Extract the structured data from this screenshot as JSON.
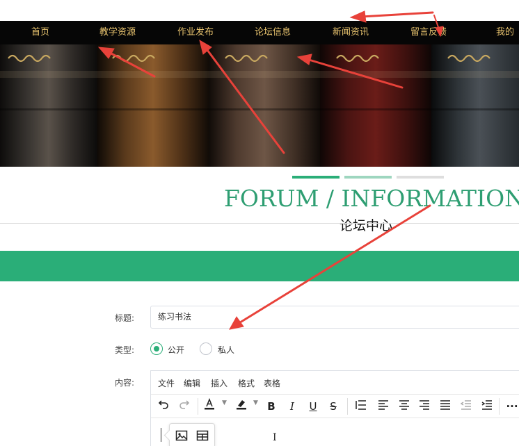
{
  "nav": {
    "items": [
      {
        "label": "首页"
      },
      {
        "label": "教学资源"
      },
      {
        "label": "作业发布"
      },
      {
        "label": "论坛信息"
      },
      {
        "label": "新闻资讯"
      },
      {
        "label": "留言反馈"
      },
      {
        "label": "我的"
      }
    ],
    "text_color": "#e9c46f",
    "background": "#060606"
  },
  "section": {
    "title_en": "FORUM / INFORMATION",
    "title_zh": "论坛中心",
    "accent_color": "#2aae78"
  },
  "form": {
    "title_label": "标题:",
    "title_value": "练习书法",
    "type_label": "类型:",
    "type_options": [
      {
        "label": "公开",
        "checked": true
      },
      {
        "label": "私人",
        "checked": false
      }
    ],
    "content_label": "内容:"
  },
  "editor": {
    "menu": [
      {
        "label": "文件"
      },
      {
        "label": "编辑"
      },
      {
        "label": "插入"
      },
      {
        "label": "格式"
      },
      {
        "label": "表格"
      }
    ],
    "toolbar_icons": [
      "undo-icon",
      "redo-icon",
      "text-color-icon",
      "highlight-icon",
      "bold-icon",
      "italic-icon",
      "underline-icon",
      "strikethrough-icon",
      "line-height-icon",
      "align-left-icon",
      "align-center-icon",
      "align-right-icon",
      "align-justify-icon",
      "outdent-icon",
      "indent-icon",
      "more-icon"
    ],
    "toolbar_glyphs": {
      "bold": "B",
      "italic": "I",
      "underline": "U",
      "strike": "S",
      "more": "···"
    },
    "quick_insert_icons": [
      "image-icon",
      "table-icon"
    ]
  },
  "annotation_arrow_color": "#e8423a"
}
